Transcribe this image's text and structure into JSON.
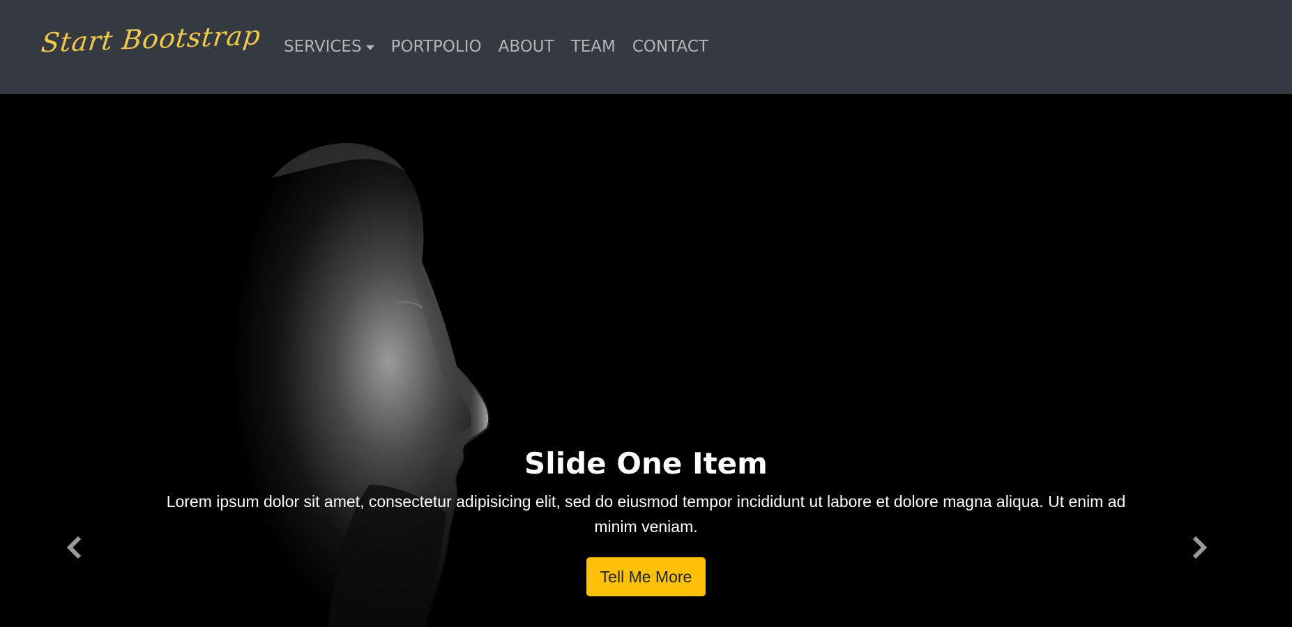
{
  "navbar": {
    "brand": "Start Bootstrap",
    "brand_color": "#f2c94c",
    "background": "#343a40",
    "links": [
      {
        "label": "SERVICES",
        "has_dropdown": true
      },
      {
        "label": "PORTPOLIO"
      },
      {
        "label": "ABOUT"
      },
      {
        "label": "TEAM"
      },
      {
        "label": "CONTACT"
      }
    ]
  },
  "carousel": {
    "slide": {
      "title": "Slide One Item",
      "text": "Lorem ipsum dolor sit amet, consectetur adipisicing elit, sed do eiusmod tempor incididunt ut labore et dolore magna aliqua. Ut enim ad minim veniam.",
      "button_label": "Tell Me More",
      "button_color": "#ffc107"
    },
    "prev_icon": "chevron-left-icon",
    "next_icon": "chevron-right-icon"
  }
}
